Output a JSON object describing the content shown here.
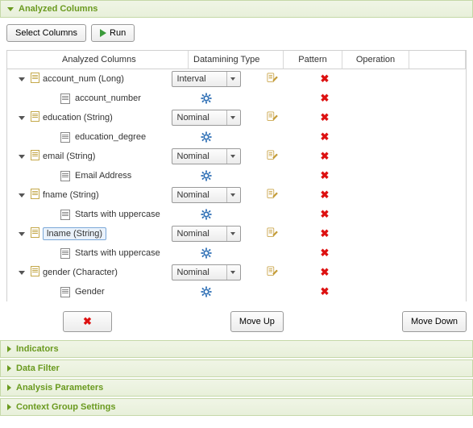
{
  "sections": {
    "analyzed": "Analyzed Columns",
    "indicators": "Indicators",
    "dataFilter": "Data Filter",
    "analysisParams": "Analysis Parameters",
    "contextGroup": "Context Group Settings"
  },
  "toolbar": {
    "selectColumns": "Select Columns",
    "run": "Run"
  },
  "headers": {
    "analyzedColumns": "Analyzed Columns",
    "dataminingType": "Datamining Type",
    "pattern": "Pattern",
    "operation": "Operation"
  },
  "rows": [
    {
      "name": "account_num (Long)",
      "dm": "Interval",
      "child": "account_number",
      "selected": false
    },
    {
      "name": "education (String)",
      "dm": "Nominal",
      "child": "education_degree",
      "selected": false
    },
    {
      "name": "email (String)",
      "dm": "Nominal",
      "child": "Email Address",
      "selected": false
    },
    {
      "name": "fname (String)",
      "dm": "Nominal",
      "child": "Starts with uppercase",
      "selected": false
    },
    {
      "name": "lname (String)",
      "dm": "Nominal",
      "child": "Starts with uppercase",
      "selected": true
    },
    {
      "name": "gender (Character)",
      "dm": "Nominal",
      "child": "Gender",
      "selected": false
    }
  ],
  "buttons": {
    "moveUp": "Move Up",
    "moveDown": "Move Down"
  }
}
